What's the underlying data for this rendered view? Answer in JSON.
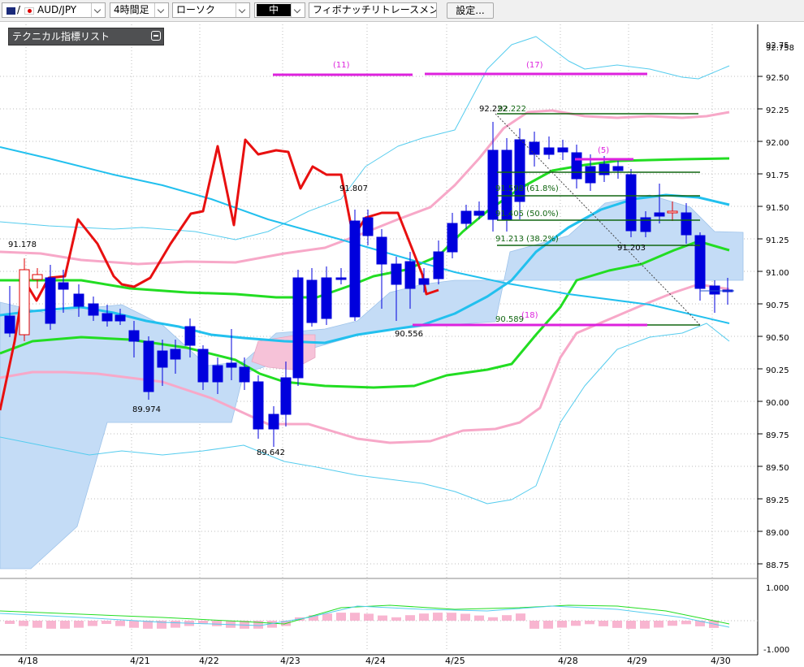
{
  "toolbar": {
    "pair": "AUD/JPY",
    "timeframe": "4時間足",
    "chart_type": "ローソク",
    "line_width": "中",
    "drawing_tool": "フィボナッチリトレースメント",
    "settings_label": "設定..."
  },
  "indicator_list": {
    "title": "テクニカル指標リスト"
  },
  "price_axis": {
    "top_labels": [
      "92.75",
      "92.758"
    ],
    "ticks": [
      "92.50",
      "92.25",
      "92.00",
      "91.75",
      "91.50",
      "91.25",
      "91.00",
      "90.75",
      "90.50",
      "90.25",
      "90.00",
      "89.75",
      "89.50",
      "89.25",
      "89.00",
      "88.75"
    ]
  },
  "osc_axis": {
    "ticks": [
      "1.000",
      "-1.000"
    ]
  },
  "date_axis": {
    "labels": [
      "4/18",
      "4/21",
      "4/22",
      "4/23",
      "4/24",
      "4/25",
      "4/28",
      "4/29",
      "4/30"
    ]
  },
  "annotations": {
    "price_labels": [
      "91.178",
      "89.974",
      "89.642",
      "91.807",
      "90.556",
      "92.222",
      "92.222",
      "91.203"
    ],
    "fib_labels": [
      "91.598 (61.8%)",
      "91.405 (50.0%)",
      "91.213 (38.2%)",
      "90.589"
    ],
    "counts": [
      "(11)",
      "(17)",
      "(5)",
      "(18)"
    ]
  },
  "colors": {
    "bull": "#e00000",
    "bear": "#0000dd",
    "red_line": "#e81010",
    "pink_band": "#f7a8c8",
    "green_line": "#22dd22",
    "cyan_line": "#22c0ee",
    "thin_cyan": "#55ccee",
    "cloud_blue": "#c4dcf6",
    "cloud_pink": "#f6c2d8",
    "magenta": "#dd22dd",
    "fib_green": "#116611"
  }
}
